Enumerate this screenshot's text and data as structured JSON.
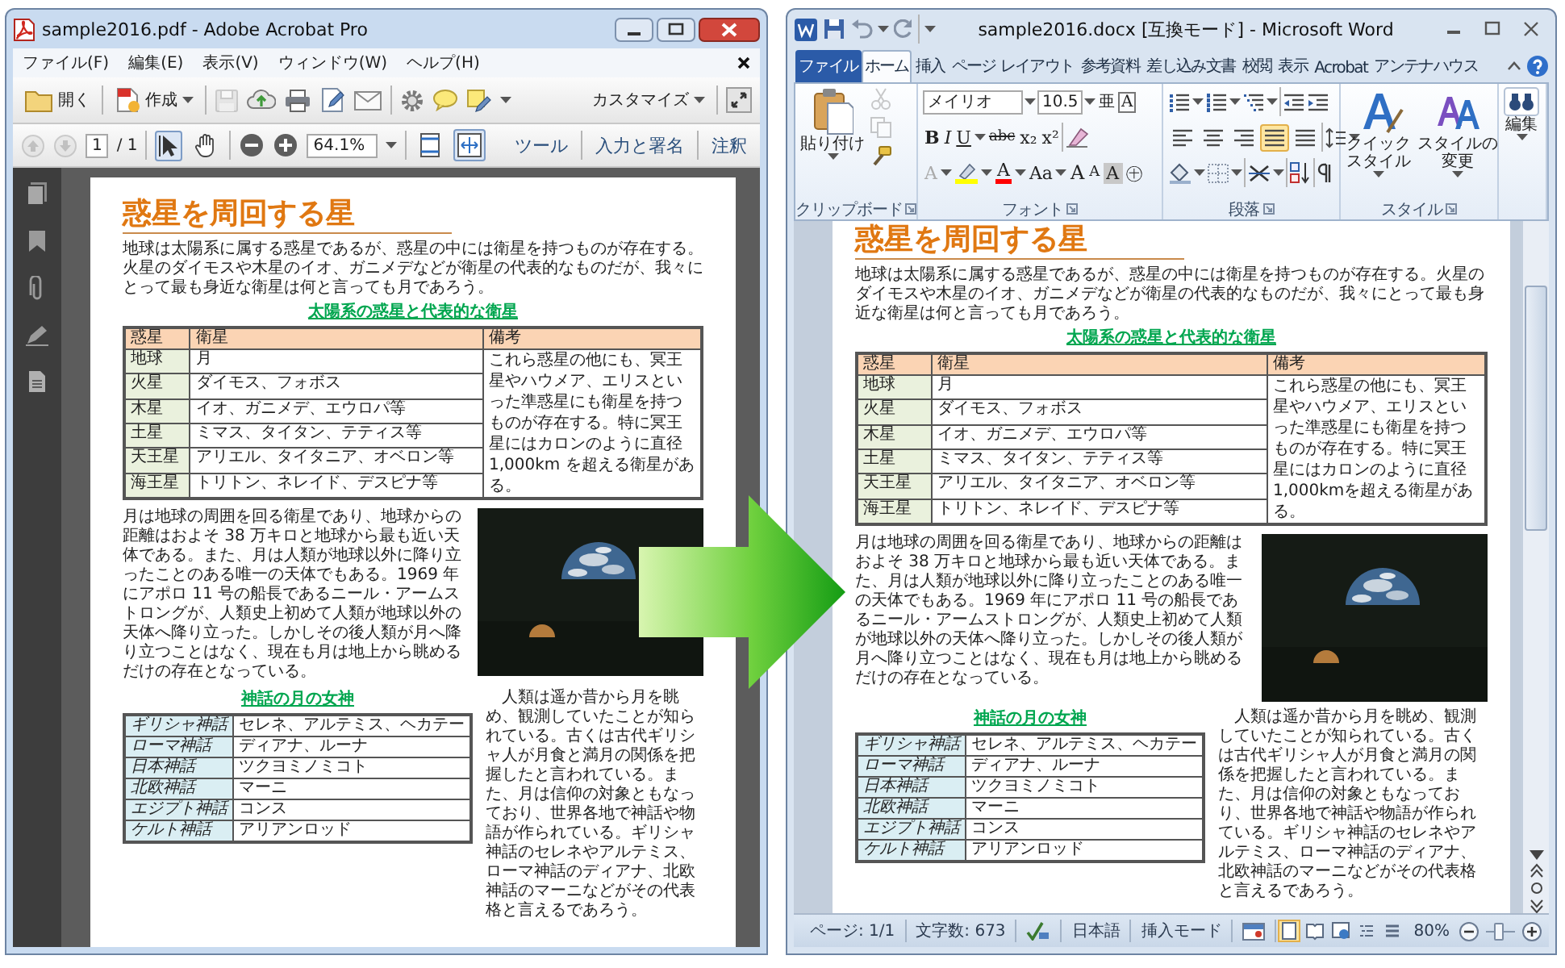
{
  "acrobat_window": {
    "title": "sample2016.pdf - Adobe Acrobat Pro",
    "menu": [
      "ファイル(F)",
      "編集(E)",
      "表示(V)",
      "ウィンドウ(W)",
      "ヘルプ(H)"
    ],
    "toolbar": {
      "open_label": "開く",
      "create_label": "作成",
      "customize_label": "カスタマイズ"
    },
    "navigation": {
      "page_buttons": [
        {
          "disabled": true
        },
        {
          "disabled": true
        }
      ],
      "page_number": "1",
      "page_count": "/ 1",
      "tools": [
        {
          "selected": true
        },
        {
          "selected": false
        }
      ],
      "zoom": "64.1%",
      "fit_buttons": [
        {
          "selected": false
        },
        {
          "selected": true
        }
      ],
      "panes": [
        "ツール",
        "入力と署名",
        "注釈"
      ]
    },
    "document": {
      "heading": "惑星を周回する星",
      "intro": "地球は太陽系に属する惑星であるが、惑星の中には衛星を持つものが存在する。火星のダイモスや木星のイオ、ガニメデなどが衛星の代表的なものだが、我々にとって最も身近な衛星は何と言っても月であろう。",
      "planet_table": {
        "caption": "太陽系の惑星と代表的な衛星",
        "columns": [
          "惑星",
          "衛星",
          "備考"
        ],
        "rows": [
          [
            "地球",
            "月"
          ],
          [
            "火星",
            "ダイモス、フォボス"
          ],
          [
            "木星",
            "イオ、ガニメデ、エウロパ等"
          ],
          [
            "土星",
            "ミマス、タイタン、テティス等"
          ],
          [
            "天王星",
            "アリエル、タイタニア、オベロン等"
          ],
          [
            "海王星",
            "トリトン、ネレイド、デスピナ等"
          ]
        ],
        "note": "これら惑星の他にも、冥王星やハウメア、エリスといった準惑星にも衛星を持つものが存在する。特に冥王星にはカロンのように直径 1,000km を超える衛星がある。"
      },
      "moon_paragraph": "月は地球の周囲を回る衛星であり、地球からの距離はおよそ 38 万キロと地球から最も近い天体である。また、月は人類が地球以外に降り立ったことのある唯一の天体でもある。1969 年にアポロ 11 号の船長であるニール・アームストロングが、人類史上初めて人類が地球以外の天体へ降り立った。しかしその後人類が月へ降り立つことはなく、現在も月は地上から眺めるだけの存在となっている。",
      "history_paragraph": "人類は遥か昔から月を眺め、観測していたことが知られている。古くは古代ギリシャ人が月食と満月の関係を把握したと言われている。また、月は信仰の対象ともなっており、世界各地で神話や物語が作られている。ギリシャ神話のセレネやアルテミス、ローマ神話のディアナ、北欧神話のマーニなどがその代表格と言えるであろう。",
      "goddess_table": {
        "caption": "神話の月の女神",
        "rows": [
          [
            "ギリシャ神話",
            "セレネ、アルテミス、ヘカテー"
          ],
          [
            "ローマ神話",
            "ディアナ、ルーナ"
          ],
          [
            "日本神話",
            "ツクヨミノミコト"
          ],
          [
            "北欧神話",
            "マーニ"
          ],
          [
            "エジプト神話",
            "コンス"
          ],
          [
            "ケルト神話",
            "アリアンロッド"
          ]
        ]
      }
    }
  },
  "word_window": {
    "title": "sample2016.docx [互換モード] - Microsoft Word",
    "ribbon_tabs": [
      {
        "label": "ファイル",
        "kind": "backstage",
        "selected": false
      },
      {
        "label": "ホーム",
        "kind": "tab",
        "selected": true
      },
      {
        "label": "挿入",
        "kind": "tab",
        "selected": false
      },
      {
        "label": "ページ レイアウト",
        "kind": "tab",
        "selected": false
      },
      {
        "label": "参考資料",
        "kind": "tab",
        "selected": false
      },
      {
        "label": "差し込み文書",
        "kind": "tab",
        "selected": false
      },
      {
        "label": "校閲",
        "kind": "tab",
        "selected": false
      },
      {
        "label": "表示",
        "kind": "tab",
        "selected": false
      },
      {
        "label": "Acrobat",
        "kind": "tab",
        "selected": false
      },
      {
        "label": "アンテナハウス",
        "kind": "tab",
        "selected": false
      }
    ],
    "ribbon": {
      "clipboard": {
        "paste_label": "貼り付け",
        "group_label": "クリップボード"
      },
      "font": {
        "font_name": "メイリオ",
        "font_size": "10.5",
        "size_glyphs": [
          "亜",
          "A"
        ],
        "format_buttons": [
          {
            "kind": "bold",
            "text": "B",
            "dropdown": false
          },
          {
            "kind": "italic",
            "text": "I",
            "dropdown": false
          },
          {
            "kind": "underline",
            "text": "U",
            "dropdown": true
          },
          {
            "kind": "strike",
            "text": "abc",
            "dropdown": false
          },
          {
            "kind": "plain",
            "text": "x₂",
            "dropdown": false
          },
          {
            "kind": "plain",
            "text": "x²",
            "dropdown": false
          }
        ],
        "effect_buttons": [
          {
            "kind": "outline",
            "text": "A",
            "dropdown": true
          },
          {
            "kind": "highlighter",
            "color": "#ffff00",
            "dropdown": true
          },
          {
            "kind": "color",
            "text": "A",
            "color": "#ff0000",
            "dropdown": true
          },
          {
            "kind": "plain",
            "text": "Aa",
            "dropdown": true
          },
          {
            "kind": "grow",
            "text": "A",
            "dropdown": false
          },
          {
            "kind": "shrink",
            "text": "A",
            "dropdown": false
          },
          {
            "kind": "shaded",
            "text": "A",
            "dropdown": false
          },
          {
            "kind": "plain",
            "text": "㊉",
            "dropdown": false
          }
        ],
        "group_label": "フォント"
      },
      "paragraph": {
        "alignment": [
          {
            "selected": false
          },
          {
            "selected": false
          },
          {
            "selected": false
          },
          {
            "selected": true
          },
          {
            "selected": false
          }
        ],
        "group_label": "段落"
      },
      "styles": {
        "quick_style_label": "クイックスタイル",
        "change_style_label": "スタイルの変更",
        "group_label": "スタイル"
      },
      "editing": {
        "label": "編集"
      }
    },
    "document": {
      "heading": "惑星を周回する星",
      "intro": "地球は太陽系に属する惑星であるが、惑星の中には衛星を持つものが存在する。火星のダイモスや木星のイオ、ガニメデなどが衛星の代表的なものだが、我々にとって最も身近な衛星は何と言っても月であろう。",
      "planet_table": {
        "caption": "太陽系の惑星と代表的な衛星",
        "columns": [
          "惑星",
          "衛星",
          "備考"
        ],
        "rows": [
          [
            "地球",
            "月"
          ],
          [
            "火星",
            "ダイモス、フォボス"
          ],
          [
            "木星",
            "イオ、ガニメデ、エウロパ等"
          ],
          [
            "土星",
            "ミマス、タイタン、テティス等"
          ],
          [
            "天王星",
            "アリエル、タイタニア、オベロン等"
          ],
          [
            "海王星",
            "トリトン、ネレイド、デスピナ等"
          ]
        ],
        "note": "これら惑星の他にも、冥王星やハウメア、エリスといった準惑星にも衛星を持つものが存在する。特に冥王星にはカロンのように直径1,000kmを超える衛星がある。"
      },
      "moon_paragraph": "月は地球の周囲を回る衛星であり、地球からの距離はおよそ 38 万キロと地球から最も近い天体である。また、月は人類が地球以外に降り立ったことのある唯一の天体でもある。1969 年にアポロ 11 号の船長であるニール・アームストロングが、人類史上初めて人類が地球以外の天体へ降り立った。しかしその後人類が月へ降り立つことはなく、現在も月は地上から眺めるだけの存在となっている。",
      "history_paragraph": "人類は遥か昔から月を眺め、観測していたことが知られている。古くは古代ギリシャ人が月食と満月の関係を把握したと言われている。また、月は信仰の対象ともなっており、世界各地で神話や物語が作られている。ギリシャ神話のセレネやアルテミス、ローマ神話のディアナ、北欧神話のマーニなどがその代表格と言えるであろう。",
      "goddess_table": {
        "caption": "神話の月の女神",
        "rows": [
          [
            "ギリシャ神話",
            "セレネ、アルテミス、ヘカテー"
          ],
          [
            "ローマ神話",
            "ディアナ、ルーナ"
          ],
          [
            "日本神話",
            "ツクヨミノミコト"
          ],
          [
            "北欧神話",
            "マーニ"
          ],
          [
            "エジプト神話",
            "コンス"
          ],
          [
            "ケルト神話",
            "アリアンロッド"
          ]
        ]
      }
    },
    "status_bar": {
      "items": [
        {
          "kind": "text",
          "text": "ページ: 1/1"
        },
        {
          "kind": "text",
          "text": "文字数: 673"
        },
        {
          "kind": "proofing"
        },
        {
          "kind": "text",
          "text": "日本語"
        },
        {
          "kind": "text",
          "text": "挿入モード"
        },
        {
          "kind": "macro"
        }
      ],
      "views": [
        {
          "selected": true
        },
        {
          "selected": false
        },
        {
          "selected": false
        },
        {
          "selected": false
        },
        {
          "selected": false
        }
      ],
      "zoom": "80%",
      "zoom_slider": {
        "level": 0.45
      }
    }
  }
}
